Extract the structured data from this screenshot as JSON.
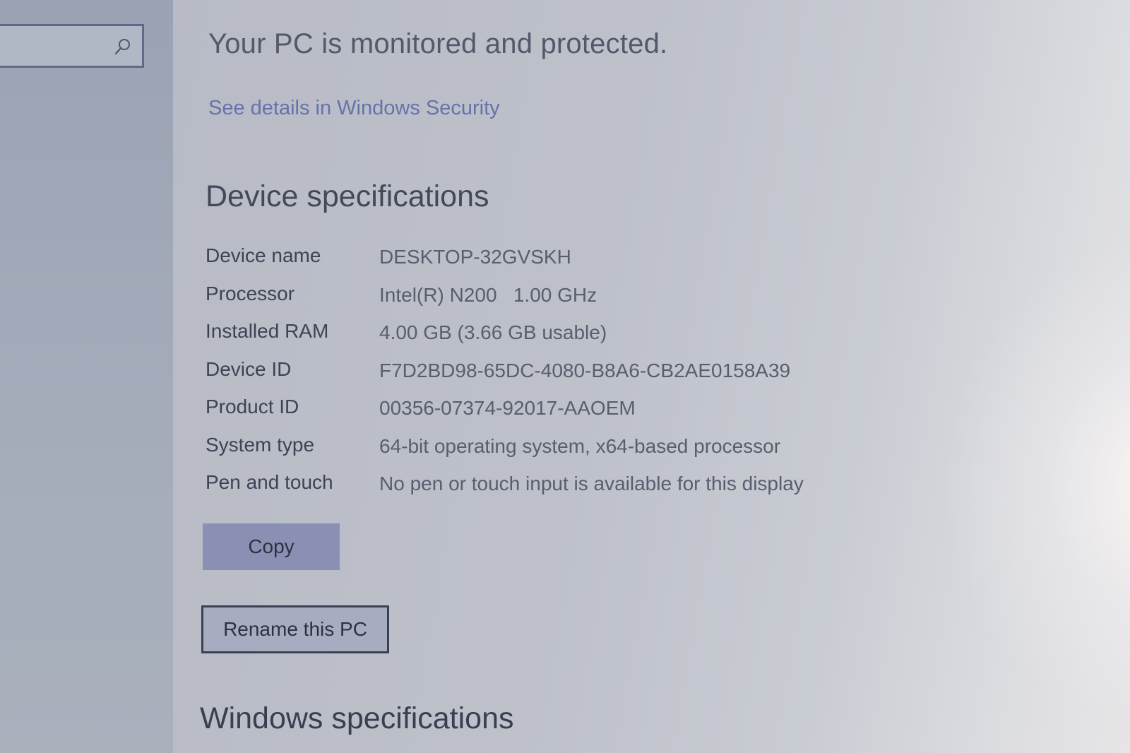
{
  "sidebar": {
    "search": {
      "value": "",
      "placeholder": "",
      "icon": "search-icon"
    }
  },
  "security": {
    "heading": "Your PC is monitored and protected.",
    "link": "See details in Windows Security"
  },
  "device_specs": {
    "heading": "Device specifications",
    "rows": [
      {
        "label": "Device name",
        "value": "DESKTOP-32GVSKH"
      },
      {
        "label": "Processor",
        "value": "Intel(R) N200   1.00 GHz"
      },
      {
        "label": "Installed RAM",
        "value": "4.00 GB (3.66 GB usable)"
      },
      {
        "label": "Device ID",
        "value": "F7D2BD98-65DC-4080-B8A6-CB2AE0158A39"
      },
      {
        "label": "Product ID",
        "value": "00356-07374-92017-AAOEM"
      },
      {
        "label": "System type",
        "value": "64-bit operating system, x64-based processor"
      },
      {
        "label": "Pen and touch",
        "value": "No pen or touch input is available for this display"
      }
    ],
    "copy_label": "Copy",
    "rename_label": "Rename this PC"
  },
  "windows_specs": {
    "heading": "Windows specifications"
  },
  "colors": {
    "accent_button": "#8a90b4",
    "link": "#6673ab"
  }
}
